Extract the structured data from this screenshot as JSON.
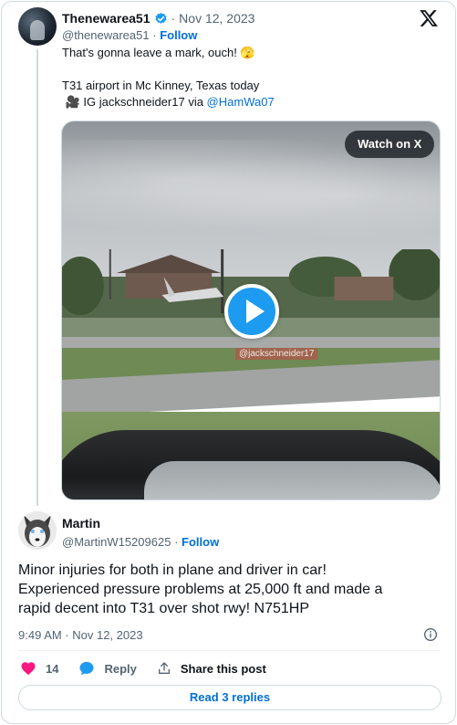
{
  "quoted_tweet": {
    "display_name": "Thenewarea51",
    "handle": "@thenewarea51",
    "date": "Nov 12, 2023",
    "separator": "·",
    "follow_label": "Follow",
    "text_lines": [
      "That's gonna leave a mark, ouch! 🫣",
      "",
      "T31 airport in Mc Kinney, Texas today",
      "🎥 IG jackschneider17 via "
    ],
    "mention": "@HamWa07",
    "media": {
      "watch_label": "Watch on X",
      "watermark": "@jackschneider17"
    }
  },
  "tweet": {
    "display_name": "Martin",
    "handle": "@MartinW15209625",
    "separator": "·",
    "follow_label": "Follow",
    "text_lines": [
      "Minor injuries for both in plane and driver in car!",
      "Experienced pressure problems at 25,000 ft and made a",
      "rapid decent into T31 over shot rwy! N751HP"
    ],
    "timestamp": "9:49 AM · Nov 12, 2023",
    "likes": "14",
    "reply_label": "Reply",
    "share_label": "Share this post",
    "read_replies_label": "Read 3 replies"
  },
  "colors": {
    "link": "#006fd6",
    "verified": "#1d9bf0",
    "like": "#f91880",
    "reply": "#1d9bf0",
    "secondary_text": "#536471"
  },
  "icons": [
    "verified-badge-icon",
    "x-logo-icon",
    "play-icon",
    "info-icon",
    "heart-icon",
    "reply-bubble-icon",
    "share-icon"
  ]
}
